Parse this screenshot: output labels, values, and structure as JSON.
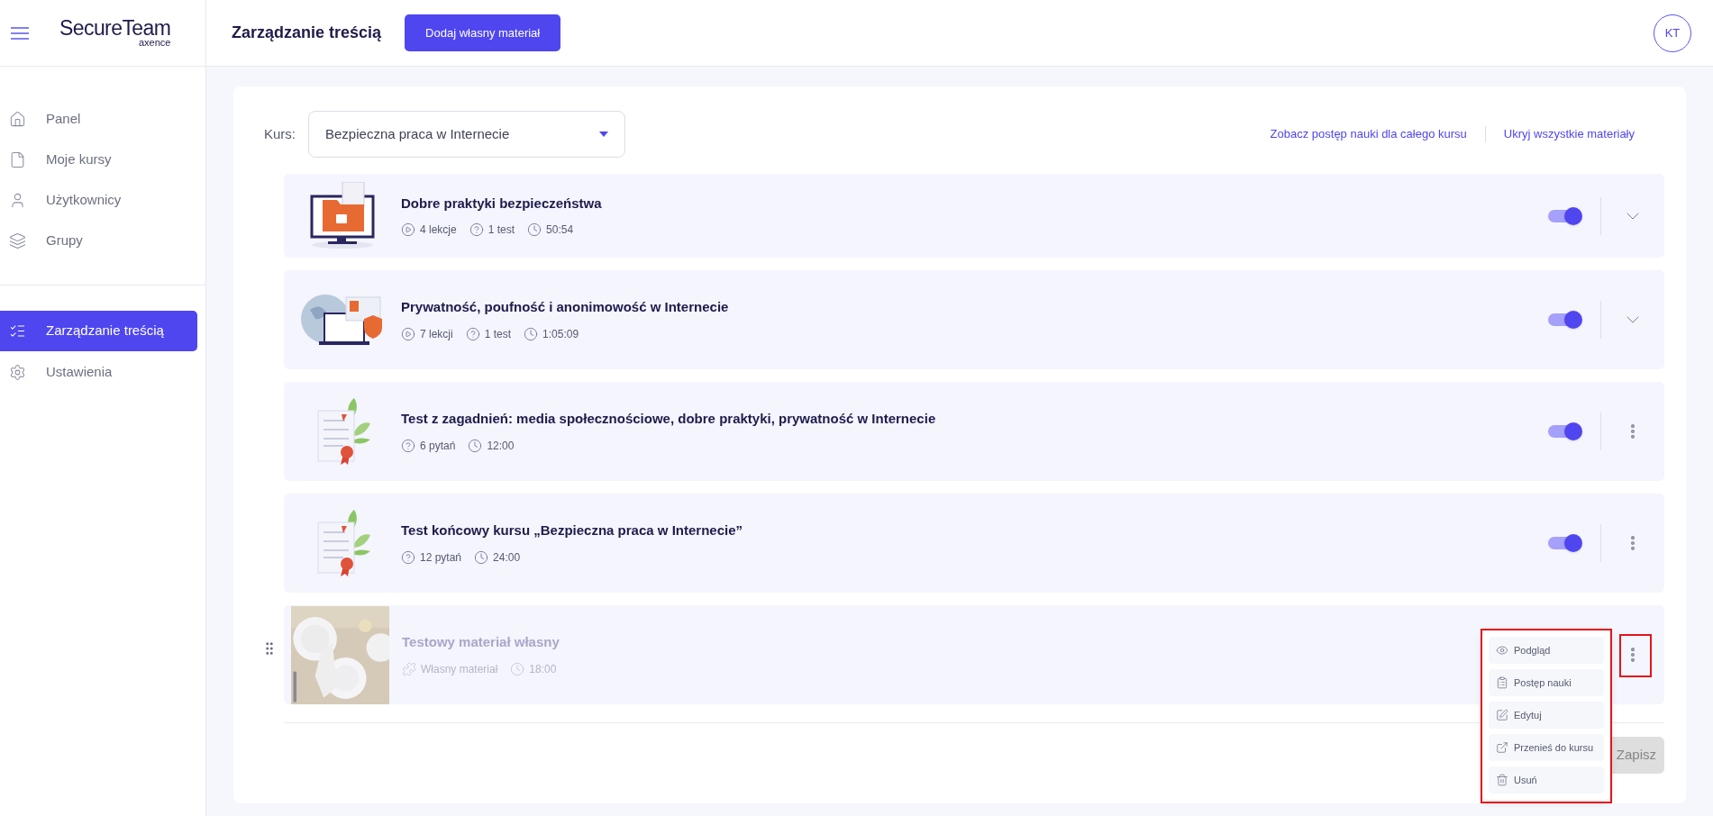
{
  "sidebar": {
    "logo": {
      "name": "SecureTeam",
      "sub": "axence"
    },
    "items": [
      {
        "label": "Panel",
        "selected": false
      },
      {
        "label": "Moje kursy",
        "selected": false
      },
      {
        "label": "Użytkownicy",
        "selected": false
      },
      {
        "label": "Grupy",
        "selected": false
      }
    ],
    "items2": [
      {
        "label": "Zarządzanie treścią",
        "selected": true
      },
      {
        "label": "Ustawienia",
        "selected": false
      }
    ]
  },
  "header": {
    "title": "Zarządzanie treścią",
    "button": "Dodaj własny materiał",
    "avatar": "KT"
  },
  "course": {
    "label": "Kurs:",
    "value": "Bezpieczna praca w Internecie",
    "links": [
      "Zobacz postęp nauki dla całego kursu",
      "Ukryj wszystkie materiały"
    ]
  },
  "materials": [
    {
      "kind": "lessons",
      "title": "Dobre praktyki bezpieczeństwa",
      "hidden": false,
      "on": true,
      "meta": [
        {
          "kind": "lessons",
          "text": "4 lekcje"
        },
        {
          "kind": "tests",
          "text": "1 test"
        },
        {
          "kind": "time",
          "text": "50:54"
        }
      ]
    },
    {
      "kind": "lessons",
      "title": "Prywatność, poufność i anonimowość w Internecie",
      "hidden": false,
      "on": true,
      "meta": [
        {
          "kind": "lessons",
          "text": "7 lekcji"
        },
        {
          "kind": "tests",
          "text": "1 test"
        },
        {
          "kind": "time",
          "text": "1:05:09"
        }
      ]
    },
    {
      "kind": "test",
      "title": "Test z zagadnień: media społecznościowe, dobre praktyki, prywatność w Internecie",
      "hidden": false,
      "on": true,
      "meta": [
        {
          "kind": "tests",
          "text": "6 pytań"
        },
        {
          "kind": "time",
          "text": "12:00"
        }
      ]
    },
    {
      "kind": "test",
      "title": "Test końcowy kursu „Bezpieczna praca w Internecie”",
      "hidden": false,
      "on": true,
      "meta": [
        {
          "kind": "tests",
          "text": "12 pytań"
        },
        {
          "kind": "time",
          "text": "24:00"
        }
      ]
    },
    {
      "kind": "custom",
      "title": "Testowy materiał własny",
      "hidden": true,
      "meta": [
        {
          "kind": "custom",
          "text": "Własny materiał"
        },
        {
          "kind": "time",
          "text": "18:00"
        }
      ]
    }
  ],
  "save_button": {
    "label": "Zapisz",
    "disabled": true
  },
  "menu": {
    "items": [
      {
        "label": "Podgląd"
      },
      {
        "label": "Postęp nauki"
      },
      {
        "label": "Edytuj"
      },
      {
        "label": "Przenieś do kursu"
      },
      {
        "label": "Usuń"
      }
    ]
  }
}
